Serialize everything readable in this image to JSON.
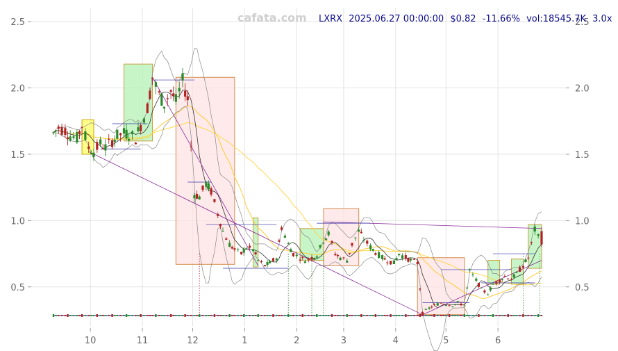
{
  "watermark": "cafata.com",
  "header": {
    "ticker": "LXRX",
    "datetime": "2025.06.27 00:00:00",
    "price": "$0.82",
    "change": "-11.66%",
    "volume": "vol:18545.7K",
    "multiplier": "3.0x"
  },
  "chart_data": {
    "type": "candlestick",
    "y_axis": {
      "min": 0.2,
      "max": 2.6,
      "ticks": [
        0.5,
        1.0,
        1.5,
        2.0,
        2.5
      ],
      "tick_labels_left": [
        "0.5",
        "1.0",
        "1.5",
        "2.0",
        "2.5"
      ],
      "tick_labels_right": [
        "0.5",
        "1.0",
        "1.5",
        "2.0",
        "2.5"
      ]
    },
    "x_axis": {
      "ticks": [
        "10",
        "11",
        "12",
        "1",
        "2",
        "3",
        "4",
        "5",
        "6"
      ],
      "tick_dates": [
        "2024-10-01",
        "2024-11-01",
        "2024-12-01",
        "2025-01-01",
        "2025-02-01",
        "2025-03-01",
        "2025-04-01",
        "2025-05-01",
        "2025-06-01"
      ],
      "start": "2024-09-09",
      "end": "2025-06-27"
    },
    "grid": true,
    "colors": {
      "up": "#2a8a2a",
      "down": "#b22222",
      "ma_short": "#333333",
      "ma_mid": "#ffcc33",
      "ma_long": "#ffd84d",
      "bollinger": "#888888",
      "trend": "#8b2a9b",
      "box_up": "#b6f2b6",
      "box_down": "#fde3e3",
      "box_yellow": "#ffff66"
    },
    "price_path": [
      [
        "2024-09-09",
        1.66
      ],
      [
        "2024-09-12",
        1.7
      ],
      [
        "2024-09-16",
        1.68
      ],
      [
        "2024-09-19",
        1.64
      ],
      [
        "2024-09-23",
        1.62
      ],
      [
        "2024-09-26",
        1.72
      ],
      [
        "2024-09-30",
        1.55
      ],
      [
        "2024-10-03",
        1.52
      ],
      [
        "2024-10-07",
        1.58
      ],
      [
        "2024-10-10",
        1.55
      ],
      [
        "2024-10-14",
        1.6
      ],
      [
        "2024-10-17",
        1.64
      ],
      [
        "2024-10-21",
        1.66
      ],
      [
        "2024-10-24",
        1.65
      ],
      [
        "2024-10-28",
        1.62
      ],
      [
        "2024-10-31",
        1.72
      ],
      [
        "2024-11-04",
        1.85
      ],
      [
        "2024-11-07",
        2.08
      ],
      [
        "2024-11-11",
        1.95
      ],
      [
        "2024-11-14",
        1.88
      ],
      [
        "2024-11-18",
        1.98
      ],
      [
        "2024-11-21",
        1.9
      ],
      [
        "2024-11-25",
        2.05
      ],
      [
        "2024-11-28",
        1.92
      ],
      [
        "2024-12-02",
        1.2
      ],
      [
        "2024-12-05",
        1.18
      ],
      [
        "2024-12-09",
        1.28
      ],
      [
        "2024-12-12",
        1.22
      ],
      [
        "2024-12-16",
        1.05
      ],
      [
        "2024-12-19",
        0.92
      ],
      [
        "2024-12-23",
        0.82
      ],
      [
        "2024-12-26",
        0.78
      ],
      [
        "2024-12-30",
        0.75
      ],
      [
        "2025-01-02",
        0.8
      ],
      [
        "2025-01-06",
        0.78
      ],
      [
        "2025-01-09",
        0.7
      ],
      [
        "2025-01-13",
        0.66
      ],
      [
        "2025-01-16",
        0.68
      ],
      [
        "2025-01-20",
        0.72
      ],
      [
        "2025-01-23",
        0.95
      ],
      [
        "2025-01-27",
        0.82
      ],
      [
        "2025-01-30",
        0.75
      ],
      [
        "2025-02-03",
        0.72
      ],
      [
        "2025-02-06",
        0.7
      ],
      [
        "2025-02-10",
        0.72
      ],
      [
        "2025-02-13",
        0.74
      ],
      [
        "2025-02-17",
        0.85
      ],
      [
        "2025-02-20",
        0.9
      ],
      [
        "2025-02-24",
        0.75
      ],
      [
        "2025-02-27",
        0.72
      ],
      [
        "2025-03-03",
        0.7
      ],
      [
        "2025-03-06",
        0.82
      ],
      [
        "2025-03-10",
        0.92
      ],
      [
        "2025-03-13",
        0.86
      ],
      [
        "2025-03-17",
        0.8
      ],
      [
        "2025-03-20",
        0.76
      ],
      [
        "2025-03-24",
        0.72
      ],
      [
        "2025-03-27",
        0.7
      ],
      [
        "2025-03-31",
        0.68
      ],
      [
        "2025-04-03",
        0.75
      ],
      [
        "2025-04-07",
        0.72
      ],
      [
        "2025-04-10",
        0.7
      ],
      [
        "2025-04-14",
        0.68
      ],
      [
        "2025-04-17",
        0.3
      ],
      [
        "2025-04-21",
        0.34
      ],
      [
        "2025-04-24",
        0.36
      ],
      [
        "2025-04-28",
        0.38
      ],
      [
        "2025-05-01",
        0.37
      ],
      [
        "2025-05-05",
        0.36
      ],
      [
        "2025-05-08",
        0.38
      ],
      [
        "2025-05-12",
        0.36
      ],
      [
        "2025-05-15",
        0.62
      ],
      [
        "2025-05-19",
        0.55
      ],
      [
        "2025-05-22",
        0.48
      ],
      [
        "2025-05-26",
        0.45
      ],
      [
        "2025-05-29",
        0.52
      ],
      [
        "2025-06-02",
        0.55
      ],
      [
        "2025-06-05",
        0.58
      ],
      [
        "2025-06-09",
        0.56
      ],
      [
        "2025-06-12",
        0.6
      ],
      [
        "2025-06-16",
        0.66
      ],
      [
        "2025-06-19",
        0.72
      ],
      [
        "2025-06-23",
        0.93
      ],
      [
        "2025-06-27",
        0.82
      ]
    ]
  }
}
